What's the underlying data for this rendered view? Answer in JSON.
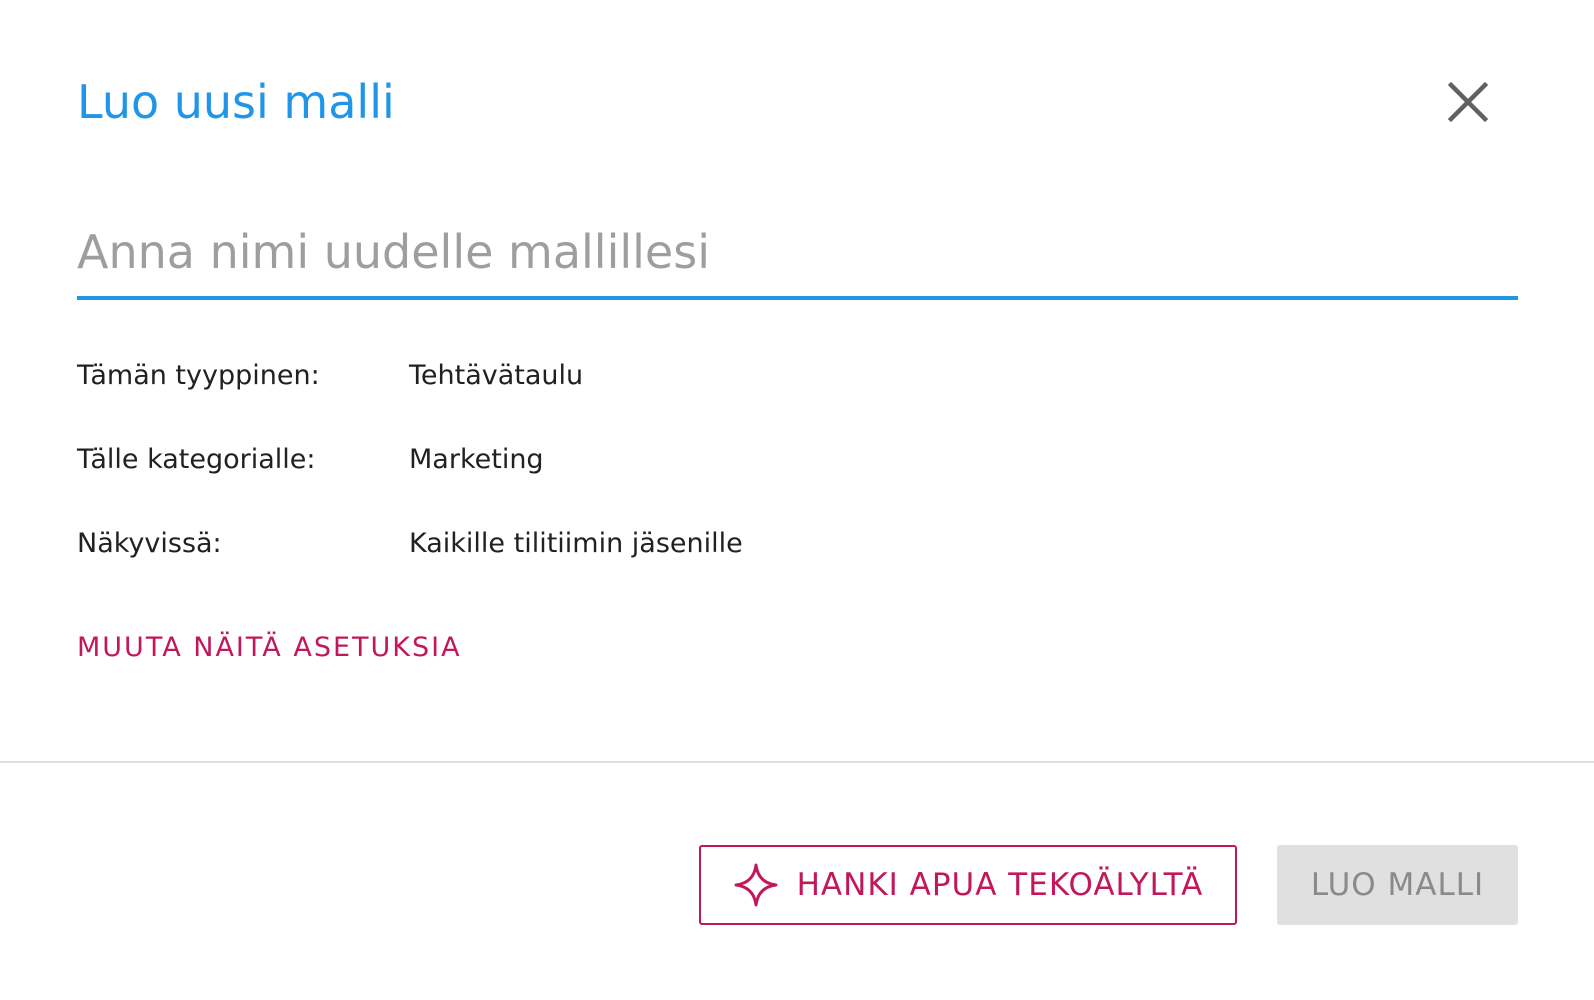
{
  "dialog": {
    "title": "Luo uusi malli",
    "close_icon": "close-icon"
  },
  "name_input": {
    "value": "",
    "placeholder": "Anna nimi uudelle mallillesi"
  },
  "settings": {
    "rows": [
      {
        "label": "Tämän tyyppinen:",
        "value": "Tehtävätaulu"
      },
      {
        "label": "Tälle kategorialle:",
        "value": "Marketing"
      },
      {
        "label": "Näkyvissä:",
        "value": "Kaikille tilitiimin jäsenille"
      }
    ],
    "change_link": "MUUTA NÄITÄ ASETUKSIA"
  },
  "footer": {
    "ai_button_label": "HANKI APUA TEKOÄLYLTÄ",
    "ai_button_icon": "sparkle-icon",
    "create_button_label": "LUO MALLI",
    "create_button_disabled": true
  },
  "colors": {
    "primary": "#2196e8",
    "accent": "#c2185b",
    "disabled_bg": "#e0e0e0",
    "disabled_text": "#8a8a8a"
  }
}
